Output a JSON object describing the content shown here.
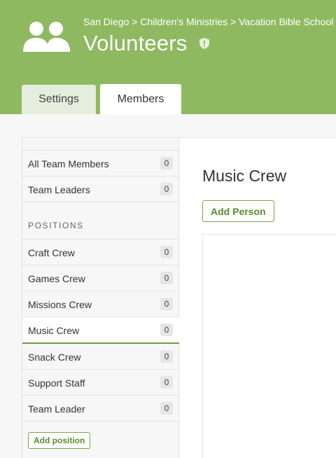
{
  "header": {
    "breadcrumb": "San Diego > Children's Ministries > Vacation Bible School",
    "title": "Volunteers",
    "icon": "team-icon",
    "badge_icon": "shield-icon",
    "bg_color": "#8fb960"
  },
  "tabs": [
    {
      "label": "Settings",
      "active": false
    },
    {
      "label": "Members",
      "active": true
    }
  ],
  "sidebar": {
    "top_items": [
      {
        "label": "All Team Members",
        "count": "0"
      },
      {
        "label": "Team Leaders",
        "count": "0"
      }
    ],
    "positions_heading": "POSITIONS",
    "positions": [
      {
        "label": "Craft Crew",
        "count": "0"
      },
      {
        "label": "Games Crew",
        "count": "0"
      },
      {
        "label": "Missions Crew",
        "count": "0"
      },
      {
        "label": "Music Crew",
        "count": "0",
        "active": true
      },
      {
        "label": "Snack Crew",
        "count": "0"
      },
      {
        "label": "Support Staff",
        "count": "0"
      },
      {
        "label": "Team Leader",
        "count": "0"
      }
    ],
    "add_position_label": "Add position"
  },
  "main": {
    "title": "Music Crew",
    "add_person_label": "Add Person"
  },
  "colors": {
    "accent": "#7aa548",
    "accent_text": "#5a8a2c"
  }
}
